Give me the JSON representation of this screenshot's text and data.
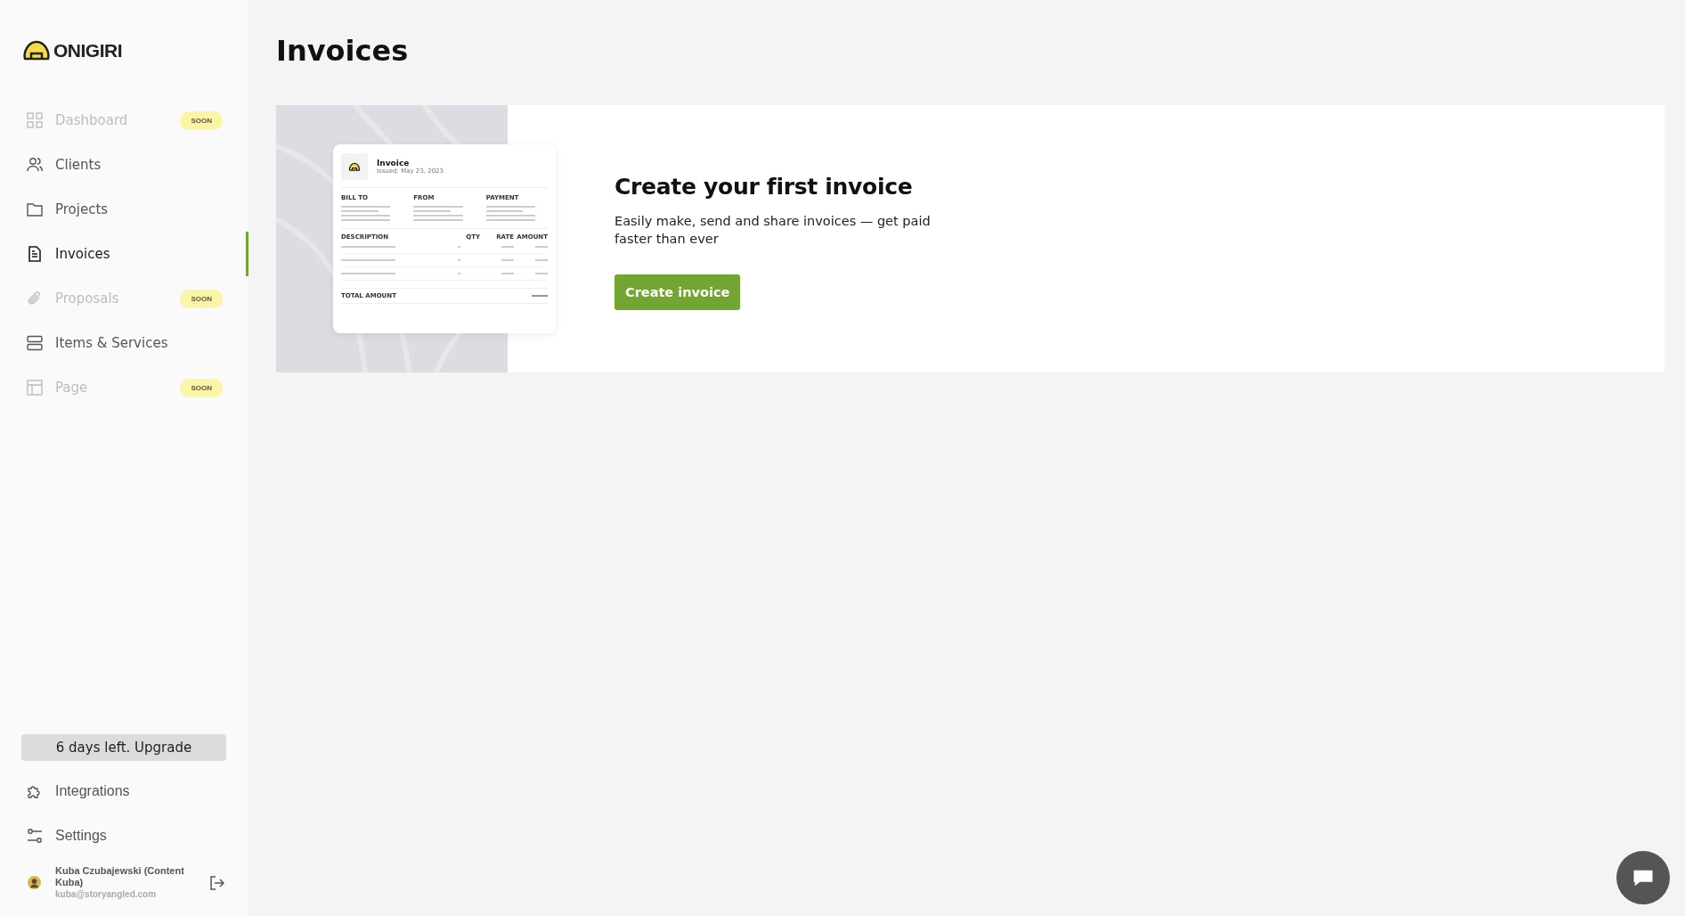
{
  "sidebar": {
    "logo": "ONIGIRI",
    "items": [
      {
        "label": "Dashboard",
        "badge": "SOON",
        "disabled": true,
        "selected": false
      },
      {
        "label": "Clients",
        "disabled": false,
        "selected": false
      },
      {
        "label": "Projects",
        "disabled": false,
        "selected": false
      },
      {
        "label": "Invoices",
        "disabled": false,
        "selected": true
      },
      {
        "label": "Proposals",
        "badge": "SOON",
        "disabled": true,
        "selected": false
      },
      {
        "label": "Items & Services",
        "disabled": false,
        "selected": false
      },
      {
        "label": "Page",
        "badge": "SOON",
        "disabled": true,
        "selected": false
      }
    ],
    "upgrade_button": "6 days left. Upgrade",
    "bottom_items": [
      {
        "label": "Integrations"
      },
      {
        "label": "Settings"
      }
    ],
    "user": {
      "name": "Kuba Czubajewski (Content Kuba)",
      "email": "kuba@storyangled.com"
    }
  },
  "page": {
    "title": "Invoices"
  },
  "empty_state": {
    "preview": {
      "title": "Invoice",
      "issued": "Issued: May 23, 2023",
      "sections": [
        "BILL TO",
        "FROM",
        "PAYMENT"
      ],
      "columns": [
        "DESCRIPTION",
        "QTY",
        "RATE",
        "AMOUNT"
      ],
      "total_label": "TOTAL AMOUNT"
    },
    "heading": "Create your first invoice",
    "text": "Easily make, send and share invoices — get paid faster than ever",
    "button": "Create invoice"
  }
}
